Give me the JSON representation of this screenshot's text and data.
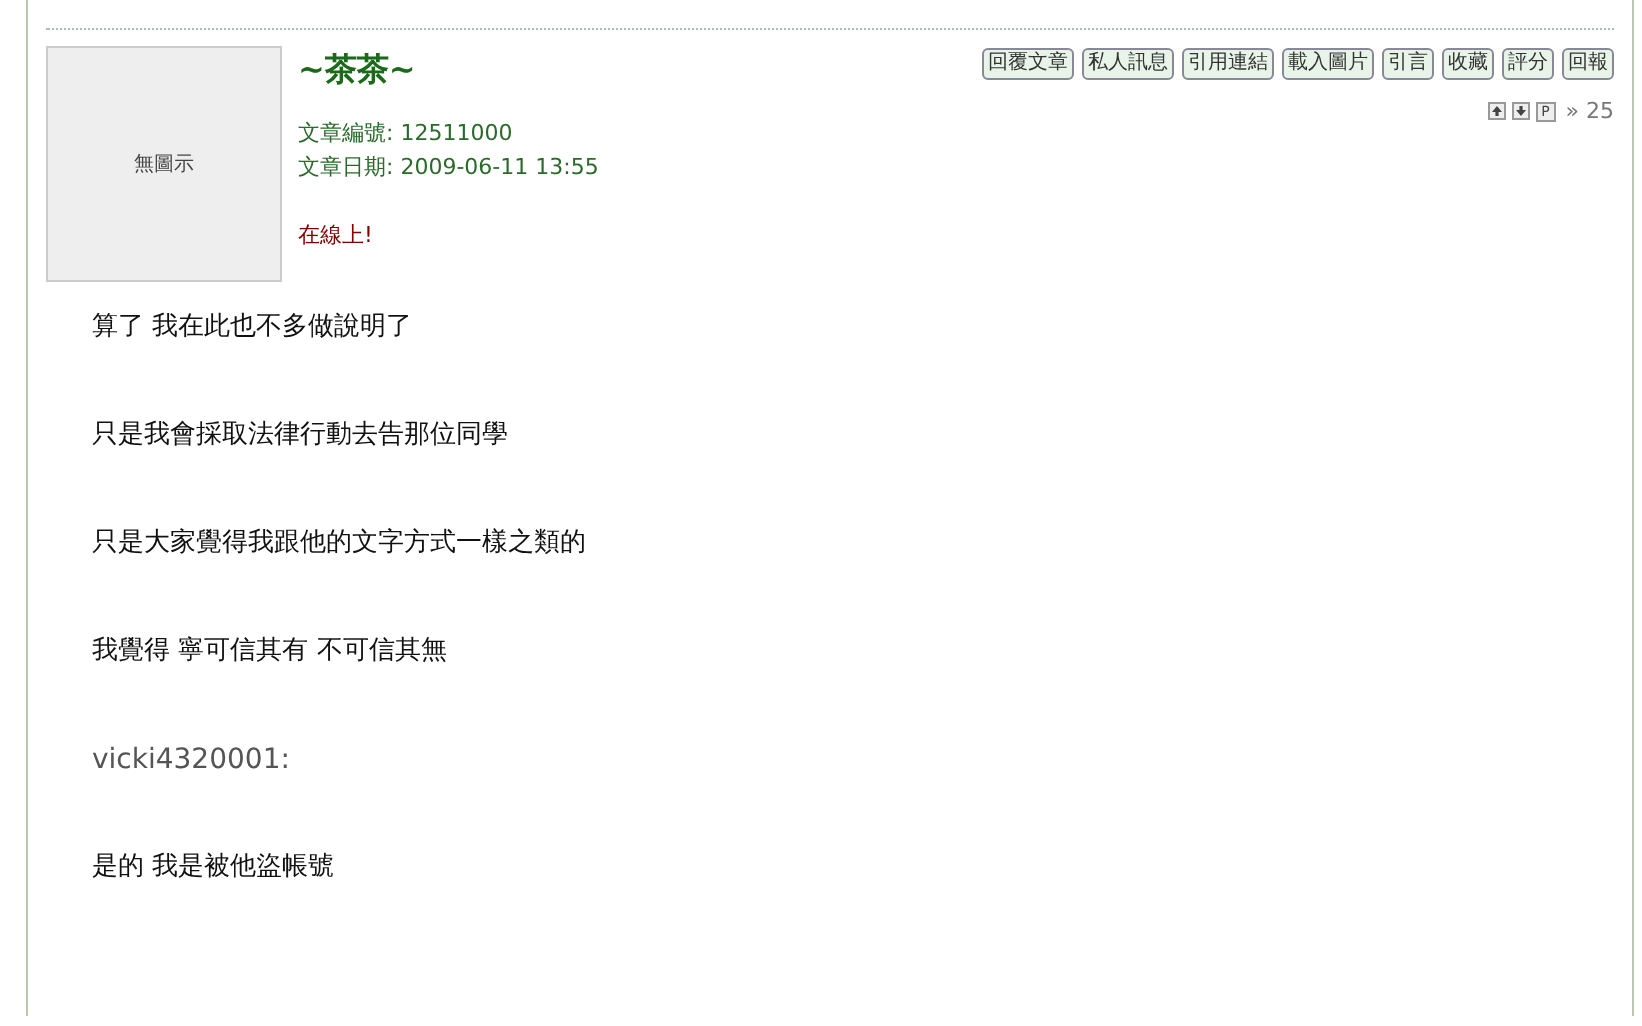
{
  "post": {
    "avatar_text": "無圖示",
    "author": "~茶茶~",
    "meta": [
      {
        "label": "文章編號:",
        "value": "12511000"
      },
      {
        "label": "文章日期:",
        "value": "2009-06-11 13:55"
      }
    ],
    "status": "在線上!",
    "buttons": [
      "回覆文章",
      "私人訊息",
      "引用連結",
      "載入圖片",
      "引言",
      "收藏",
      "評分",
      "回報"
    ],
    "nav": [
      {
        "kind": "up"
      },
      {
        "kind": "down"
      },
      {
        "kind": "page",
        "label": "P"
      }
    ],
    "floor": "» 25",
    "body": [
      {
        "kind": "text",
        "text": "算了 我在此也不多做說明了"
      },
      {
        "kind": "text",
        "text": "只是我會採取法律行動去告那位同學"
      },
      {
        "kind": "text",
        "text": "只是大家覺得我跟他的文字方式一樣之類的"
      },
      {
        "kind": "text",
        "text": "我覺得 寧可信其有 不可信其無"
      },
      {
        "kind": "quote",
        "text": "vicki4320001:"
      },
      {
        "kind": "text",
        "text": "是的 我是被他盜帳號"
      }
    ]
  }
}
